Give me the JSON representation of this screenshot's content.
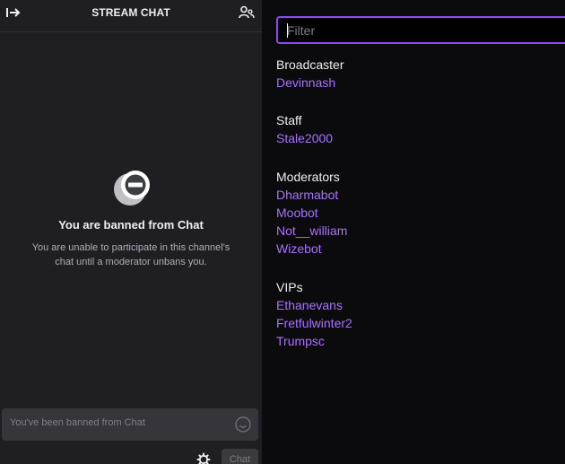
{
  "chat": {
    "title": "STREAM CHAT",
    "ban_title": "You are banned from Chat",
    "ban_description": "You are unable to participate in this channel's chat until a moderator unbans you.",
    "input_placeholder": "You've been banned from Chat",
    "send_label": "Chat",
    "icons": {
      "collapse": "collapse-arrow-icon",
      "users": "community-users-icon",
      "ban": "ban-icon",
      "emote": "emote-smiley-icon",
      "settings": "gear-icon"
    }
  },
  "viewers": {
    "filter_placeholder": "Filter",
    "sections": [
      {
        "heading": "Broadcaster",
        "users": [
          "Devinnash"
        ]
      },
      {
        "heading": "Staff",
        "users": [
          "Stale2000"
        ]
      },
      {
        "heading": "Moderators",
        "users": [
          "Dharmabot",
          "Moobot",
          "Not__william",
          "Wizebot"
        ]
      },
      {
        "heading": "VIPs",
        "users": [
          "Ethanevans",
          "Fretfulwinter2",
          "Trumpsc"
        ]
      }
    ]
  },
  "colors": {
    "accent": "#9147ff",
    "username": "#a970ff",
    "chat_bg": "#1f1f23",
    "viewers_bg": "#0b0b0d"
  }
}
